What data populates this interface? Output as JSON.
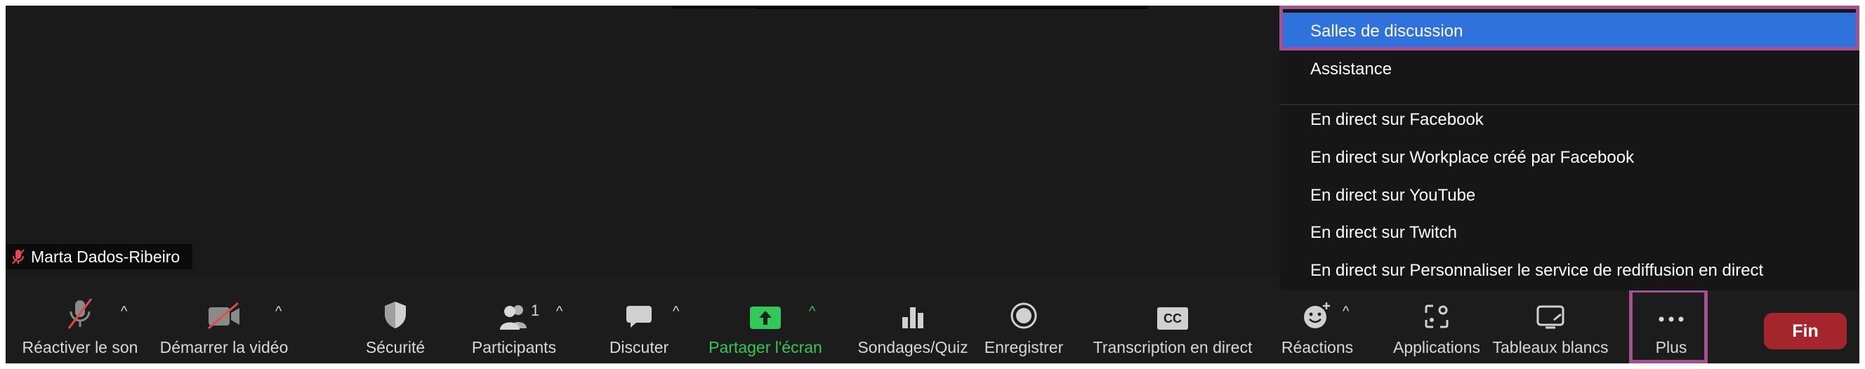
{
  "video": {
    "participant_name": "Marta Dados-Ribeiro"
  },
  "menu": {
    "items": [
      {
        "label": "Salles de discussion",
        "selected": true
      },
      {
        "label": "Assistance"
      },
      {
        "label": "En direct sur Facebook"
      },
      {
        "label": "En direct sur Workplace créé par Facebook"
      },
      {
        "label": "En direct sur YouTube"
      },
      {
        "label": "En direct sur Twitch"
      },
      {
        "label": "En direct sur Personnaliser le service de rediffusion en direct"
      }
    ]
  },
  "toolbar": {
    "unmute_label": "Réactiver le son",
    "start_video_label": "Démarrer la vidéo",
    "security_label": "Sécurité",
    "participants_label": "Participants",
    "participants_count": "1",
    "chat_label": "Discuter",
    "share_screen_label": "Partager l'écran",
    "polls_label": "Sondages/Quiz",
    "record_label": "Enregistrer",
    "transcription_label": "Transcription en direct",
    "cc_text": "CC",
    "reactions_label": "Réactions",
    "apps_label": "Applications",
    "whiteboards_label": "Tableaux blancs",
    "more_label": "Plus",
    "end_label": "Fin",
    "caret": "^"
  },
  "colors": {
    "accent_green": "#34c759",
    "menu_selected": "#2f72db",
    "end_button": "#a4262c",
    "highlight_border": "#a05292",
    "mute_red": "#e5484d"
  }
}
